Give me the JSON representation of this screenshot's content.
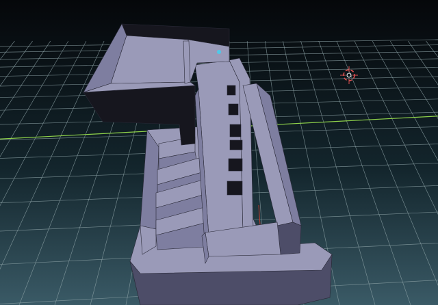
{
  "viewport": {
    "background_top": "#05070a",
    "background_bottom": "#3a5a66"
  },
  "grid": {
    "line_color": "#8fa4a8",
    "x_axis_color": "#8fd24a",
    "z_axis_color": "#c03a2a"
  },
  "model": {
    "light_face_color": "#9a9ab8",
    "mid_face_color": "#7e7ea0",
    "shadow_face_color": "#4d4d68",
    "dark_face_color": "#16161e",
    "selected_vertex_color": "#4ec9e8"
  },
  "cursor": {
    "icon": "3d-cursor-icon",
    "ring_color": "#e05050",
    "inner_color": "#ffffff"
  }
}
